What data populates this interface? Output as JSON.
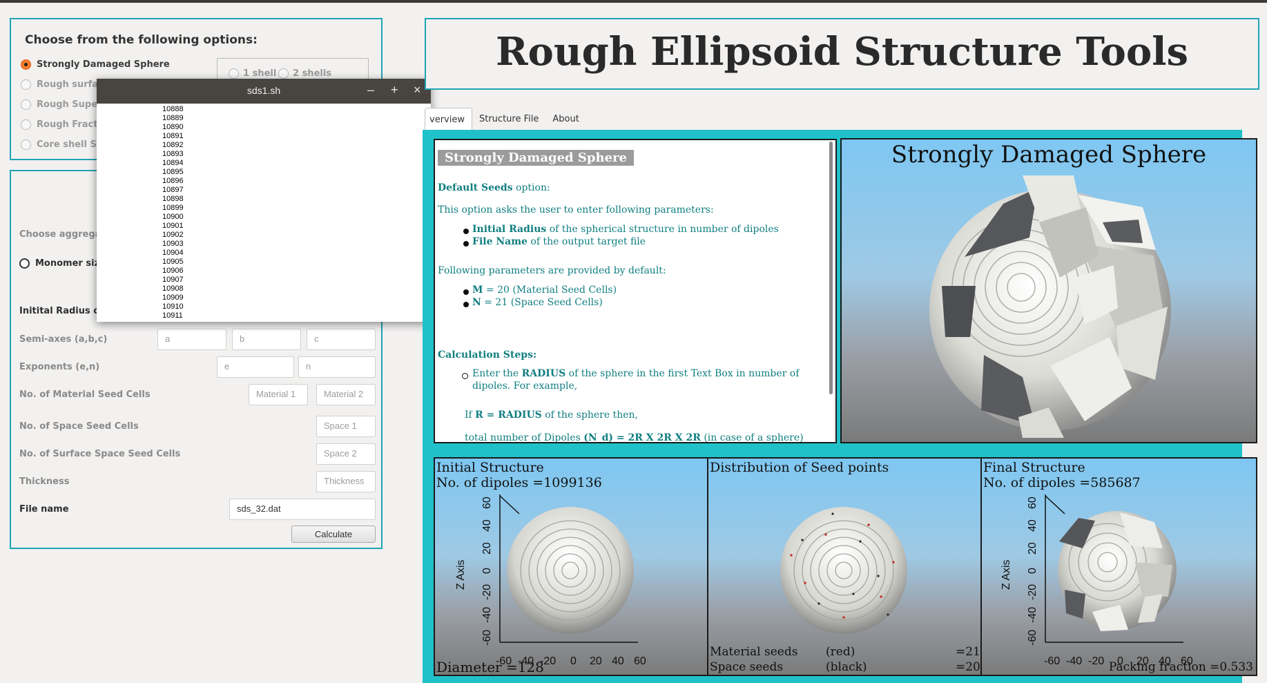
{
  "options": {
    "title": "Choose from the following options:",
    "radios": [
      "Strongly Damaged Sphere",
      "Rough surface",
      "Rough Supere",
      "Rough Fractal",
      "Core shell Sph"
    ],
    "shells": [
      "1 shell",
      "2 shells"
    ]
  },
  "params": {
    "aggregate_label": "Choose aggregate",
    "monomer_label": "Monomer size",
    "initial_radius_label": "Initital Radius of t",
    "semiaxes_label": "Semi-axes (a,b,c)",
    "semiaxes_placeholders": [
      "a",
      "b",
      "c"
    ],
    "exponents_label": "Exponents (e,n)",
    "exponents_placeholders": [
      "e",
      "n"
    ],
    "material_label": "No. of Material Seed Cells",
    "material_placeholders": [
      "Material 1",
      "Material 2"
    ],
    "space_label": "No. of Space Seed Cells",
    "space_placeholder": "Space 1",
    "surface_label": "No. of Surface Space Seed Cells",
    "surface_placeholder": "Space 2",
    "thickness_label": "Thickness",
    "thickness_placeholder": "Thickness",
    "filename_label": "File name",
    "filename_value": "sds_32.dat",
    "calculate": "Calculate"
  },
  "terminal": {
    "title": "sds1.sh",
    "minimize": "–",
    "maximize": "+",
    "close": "×",
    "lines": [
      "10888",
      "10889",
      "10890",
      "10891",
      "10892",
      "10893",
      "10894",
      "10895",
      "10896",
      "10897",
      "10898",
      "10899",
      "10900",
      "10901",
      "10902",
      "10903",
      "10904",
      "10905",
      "10906",
      "10907",
      "10908",
      "10909",
      "10910",
      "10911"
    ]
  },
  "app_title": "Rough Ellipsoid Structure Tools",
  "tabs": [
    "verview",
    "Structure File",
    "About"
  ],
  "doc": {
    "heading": "Strongly Damaged Sphere",
    "default_seeds_b": "Default Seeds",
    "default_seeds_t": " option:",
    "asks": "This option asks the user to enter following parameters:",
    "p1_b": "Initial Radius",
    "p1_t": " of the spherical structure in number of dipoles",
    "p2_b": "File Name",
    "p2_t": " of the output target file",
    "following": "Following parameters are provided by default:",
    "m_b": "M",
    "m_t": " = 20 (Material Seed Cells)",
    "n_b": "N",
    "n_t": " = 21  (Space Seed Cells)",
    "steps": "Calculation Steps:",
    "step1_a": "Enter the ",
    "step1_b": "RADIUS",
    "step1_c": " of the sphere in the first Text Box in number of",
    "step1_d": "dipoles. For example,",
    "if_a": "If ",
    "if_b": "R = RADIUS",
    "if_c": " of the sphere then,",
    "total_a": "total number of Dipoles ",
    "total_b": "(N_d) = 2R X 2R X 2R",
    "total_c": " (in case of a sphere)"
  },
  "render_title": "Strongly Damaged Sphere",
  "panels": {
    "initial": {
      "title": "Initial Structure",
      "dipoles": "No. of dipoles =1099136",
      "diameter": "Diameter =128"
    },
    "seeds": {
      "title": "Distribution of Seed points",
      "material": "Material seeds",
      "material_color": "(red)",
      "material_count": "=21",
      "space": "Space seeds",
      "space_color": "(black)",
      "space_count": "=20"
    },
    "final": {
      "title": "Final Structure",
      "dipoles": "No. of dipoles =585687",
      "packing": "Packing fraction =0.533"
    },
    "z_axis": "Z Axis",
    "ticks": [
      "-60",
      "-40",
      "-20",
      "0",
      "20",
      "40",
      "60"
    ]
  },
  "colors": {
    "accent": "#1ea3b3",
    "teal_bg": "#20c1c8",
    "doc_text": "#107e80",
    "radio_selected": "#f57d2b"
  }
}
